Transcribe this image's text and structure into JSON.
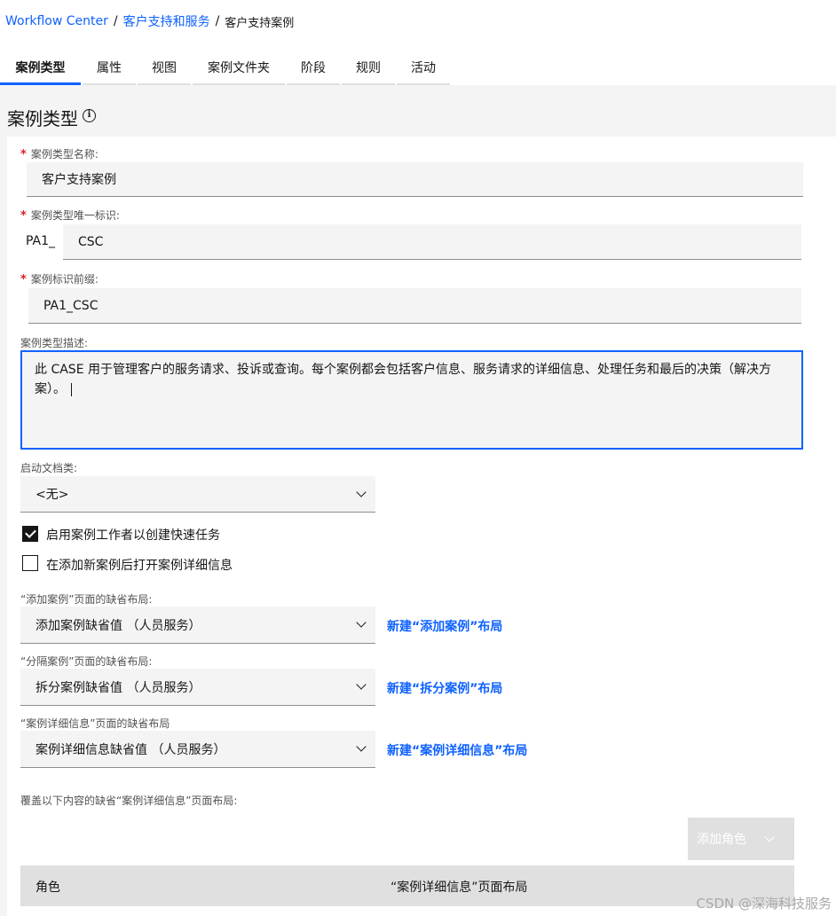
{
  "breadcrumb": {
    "root": "Workflow Center",
    "parent": "客户支持和服务",
    "current": "客户支持案例"
  },
  "tabs": [
    "案例类型",
    "属性",
    "视图",
    "案例文件夹",
    "阶段",
    "规则",
    "活动"
  ],
  "active_tab": "案例类型",
  "page_title": "案例类型",
  "info_icon_glyph": "i",
  "form": {
    "name_label": "案例类型名称:",
    "name_value": "客户支持案例",
    "id_label": "案例类型唯一标识:",
    "id_prefix": "PA1_",
    "id_value": "CSC",
    "prefix_label": "案例标识前缀:",
    "prefix_value": "PA1_CSC",
    "desc_label": "案例类型描述:",
    "desc_value": "此 CASE 用于管理客户的服务请求、投诉或查询。每个案例都会包括客户信息、服务请求的详细信息、处理任务和最后的决策（解决方案）。",
    "start_doc_label": "启动文档类:",
    "start_doc_value": "<无>",
    "checkbox1_label": "启用案例工作者以创建快速任务",
    "checkbox1_checked": true,
    "checkbox2_label": "在添加新案例后打开案例详细信息",
    "checkbox2_checked": false,
    "add_layout_label": "“添加案例”页面的缺省布局:",
    "add_layout_value": "添加案例缺省值 （人员服务）",
    "add_layout_link": "新建“添加案例”布局",
    "split_layout_label": "“分隔案例”页面的缺省布局:",
    "split_layout_value": "拆分案例缺省值 （人员服务）",
    "split_layout_link": "新建“拆分案例”布局",
    "details_layout_label": "“案例详细信息”页面的缺省布局",
    "details_layout_value": "案例详细信息缺省值 （人员服务）",
    "details_layout_link": "新建“案例详细信息”布局",
    "override_label": "覆盖以下内容的缺省“案例详细信息”页面布局:",
    "add_role_button": "添加角色"
  },
  "table": {
    "columns": [
      "角色",
      "“案例详细信息”页面布局"
    ]
  },
  "watermark": "CSDN @深海科技服务",
  "colors": {
    "accent": "#0f62fe",
    "required": "#da1e28",
    "field_bg": "#f4f4f4"
  },
  "icons": {
    "info": "info-circle-icon",
    "dropdown": "chevron-down-icon",
    "checkbox": "checkmark-icon"
  }
}
